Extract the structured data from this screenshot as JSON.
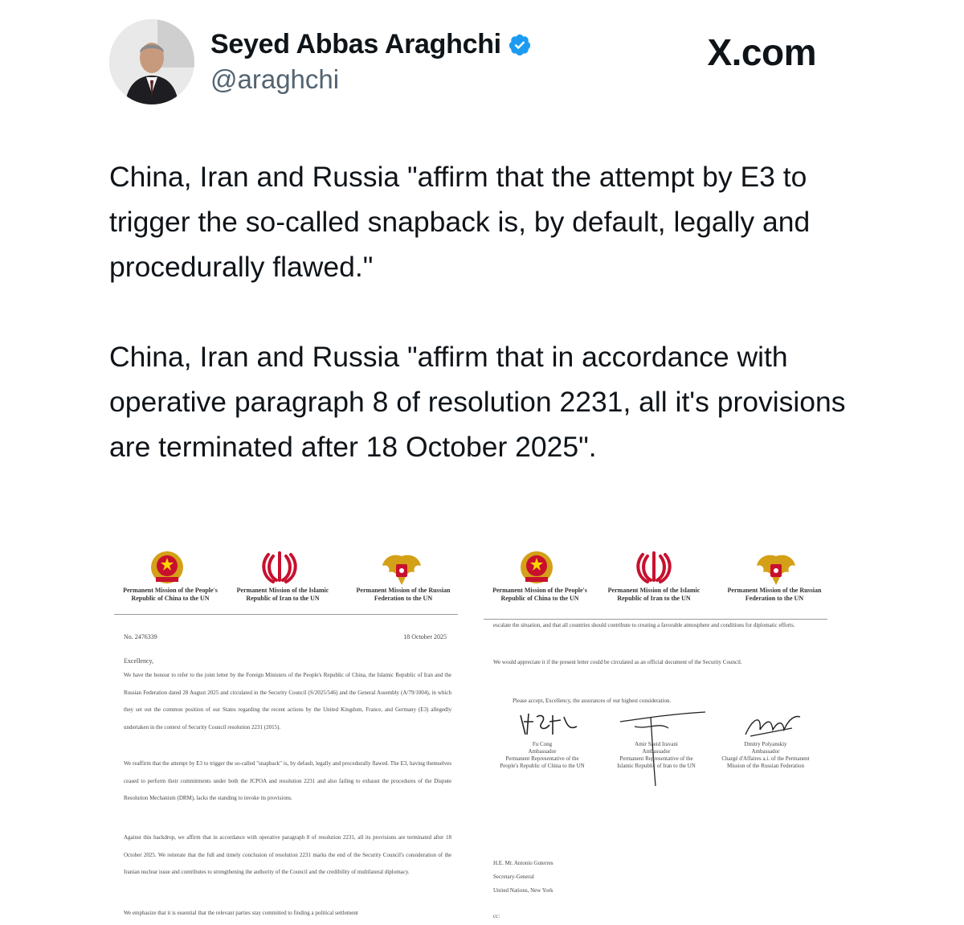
{
  "header": {
    "display_name": "Seyed Abbas Araghchi",
    "handle": "@araghchi",
    "verified_icon": "verified-badge-icon",
    "brand": "X.com",
    "colors": {
      "verified": "#1d9bf0",
      "text": "#0f1419",
      "secondary": "#536471"
    }
  },
  "tweet": {
    "paragraph_1": "China, Iran and Russia \"affirm that the attempt by E3 to trigger the so-called snapback is, by default, legally and procedurally flawed.\"",
    "paragraph_2": "China, Iran and Russia \"affirm that in accordance with operative paragraph 8 of resolution 2231, all it's provisions are terminated after 18 October 2025\"."
  },
  "letter_page_1": {
    "missions": [
      "Permanent Mission of the People's Republic of China to the UN",
      "Permanent Mission of the Islamic Republic of Iran to the UN",
      "Permanent Mission of the Russian Federation to the UN"
    ],
    "ref_no": "No. 2476339",
    "date": "18 October 2025",
    "salutation": "Excellency,",
    "paragraphs": [
      "We have the honour to refer to the joint letter by the Foreign Ministers of the People's Republic of China, the Islamic Republic of Iran and the Russian Federation dated 28 August 2025 and circulated in the Security Council (S/2025/546) and the General Assembly (A/79/1004), in which they set out the common position of our States regarding the recent actions by the United Kingdom, France, and Germany (E3) allegedly undertaken in the context of Security Council resolution 2231 (2015).",
      "We reaffirm that the attempt by E3 to trigger the so-called \"snapback\" is, by default, legally and procedurally flawed. The E3, having themselves ceased to perform their commitments under both the JCPOA and resolution 2231 and also failing to exhaust the procedures of the Dispute Resolution Mechanism (DRM), lacks the standing to invoke its provisions.",
      "Against this backdrop, we affirm that in accordance with operative paragraph 8 of resolution 2231, all its provisions are terminated after 18 October 2025. We reiterate that the full and timely conclusion of resolution 2231 marks the end of the Security Council's consideration of the Iranian nuclear issue and contributes to strengthening the authority of the Council and the credibility of multilateral diplomacy.",
      "We emphasize that it is essential that the relevant parties stay committed to finding a political settlement"
    ]
  },
  "letter_page_2": {
    "missions": [
      "Permanent Mission of the People's Republic of China to the UN",
      "Permanent Mission of the Islamic Republic of Iran to the UN",
      "Permanent Mission of the Russian Federation to the UN"
    ],
    "paragraphs": [
      "escalate the situation, and that all countries should contribute to creating a favorable atmosphere and conditions for diplomatic efforts.",
      "We would appreciate it if the present letter could be circulated as an official document of the Security Council.",
      "Please accept, Excellency, the assurances of our highest consideration."
    ],
    "signatories": [
      {
        "name": "Fu Cong",
        "title": "Ambassador",
        "role": "Permanent Representative of the People's Republic of China to the UN"
      },
      {
        "name": "Amir Saeid Iravani",
        "title": "Ambassador",
        "role": "Permanent Representative of the Islamic Republic of Iran to the UN"
      },
      {
        "name": "Dmitry Polyanskiy",
        "title": "Ambassador",
        "role": "Chargé d'Affaires a.i. of the Permanent Mission of the Russian Federation"
      }
    ],
    "recipient": [
      "H.E. Mr. Antonio Guterres",
      "Secretary-General",
      "United Nations, New York"
    ],
    "cc": "cc:"
  }
}
